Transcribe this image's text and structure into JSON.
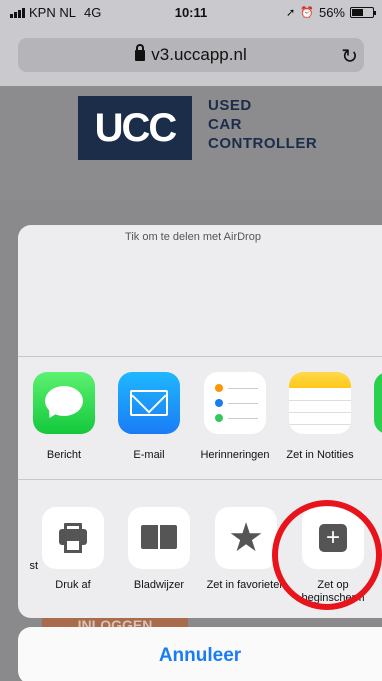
{
  "status_bar": {
    "carrier": "KPN NL",
    "network": "4G",
    "time": "10:11",
    "battery": "56%",
    "battery_level": 0.56
  },
  "browser": {
    "url": "v3.uccapp.nl"
  },
  "page": {
    "logo_mark": "UCC",
    "logo_line1": "USED",
    "logo_line2": "CAR",
    "logo_line3": "CONTROLLER",
    "login_button": "INLOGGEN"
  },
  "share_sheet": {
    "airdrop_hint": "Tik om te delen met AirDrop",
    "apps": [
      {
        "label": "Bericht",
        "icon": "messages-icon"
      },
      {
        "label": "E-mail",
        "icon": "mail-icon"
      },
      {
        "label": "Herinneringen",
        "icon": "reminders-icon"
      },
      {
        "label": "Zet in Notities",
        "icon": "notes-icon"
      }
    ],
    "actions": [
      {
        "label": "st",
        "icon": "partial-action-icon"
      },
      {
        "label": "Druk af",
        "icon": "printer-icon"
      },
      {
        "label": "Bladwijzer",
        "icon": "bookmark-icon"
      },
      {
        "label": "Zet in favorieten",
        "icon": "star-icon"
      },
      {
        "label": "Zet op beginscherm",
        "icon": "add-square-icon"
      }
    ],
    "cancel_label": "Annuleer"
  },
  "colors": {
    "accent": "#1a7cf5",
    "annotation": "#e8141b",
    "brand": "#1c2d4a"
  }
}
